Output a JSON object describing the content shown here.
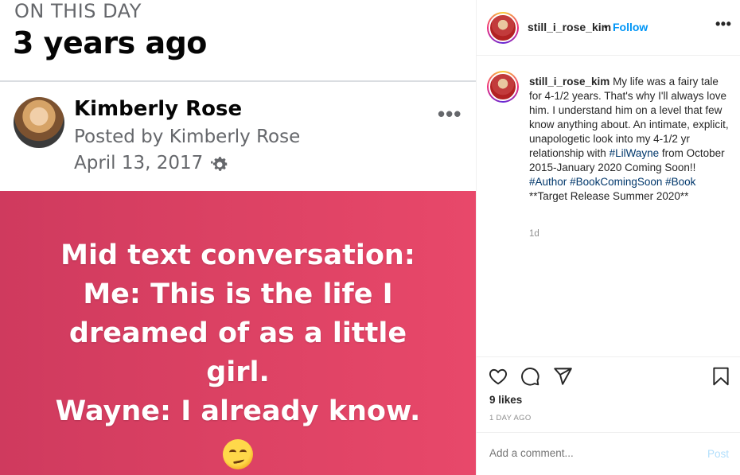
{
  "memory": {
    "label": "ON THIS DAY",
    "years": "3 years ago",
    "author_name": "Kimberly Rose",
    "posted_by": "Posted by Kimberly Rose",
    "date": "April 13, 2017 ·",
    "more": "•••",
    "card_lines": [
      "Mid text conversation:",
      "Me: This is the life I",
      "dreamed of as a little",
      "girl.",
      "Wayne:  I already know."
    ],
    "emoji": "smirking-face-emoji",
    "card_color": "#db4163"
  },
  "post": {
    "username": "still_i_rose_kim",
    "separator": "•",
    "follow_label": "Follow",
    "more": "•••",
    "caption_user": "still_i_rose_kim",
    "caption_parts": [
      {
        "text": " My life was a fairy tale for 4-1/2 years. That's why I'll always love him. I understand him on a level that few know anything about. An intimate, explicit, unapologetic look into my 4-1/2 yr relationship with ",
        "tag": false
      },
      {
        "text": "#LilWayne",
        "tag": true
      },
      {
        "text": " from October 2015-January 2020 Coming Soon!! ",
        "tag": false
      },
      {
        "text": "#Author",
        "tag": true
      },
      {
        "text": " ",
        "tag": false
      },
      {
        "text": "#BookComingSoon",
        "tag": true
      },
      {
        "text": " ",
        "tag": false
      },
      {
        "text": "#Book",
        "tag": true
      },
      {
        "text": " **Target Release Summer 2020**",
        "tag": false
      }
    ],
    "caption_time": "1d",
    "likes": "9 likes",
    "time_ago": "1 DAY AGO",
    "comment_placeholder": "Add a comment...",
    "post_label": "Post",
    "accent_color": "#0095f6",
    "hashtag_color": "#00376b"
  }
}
